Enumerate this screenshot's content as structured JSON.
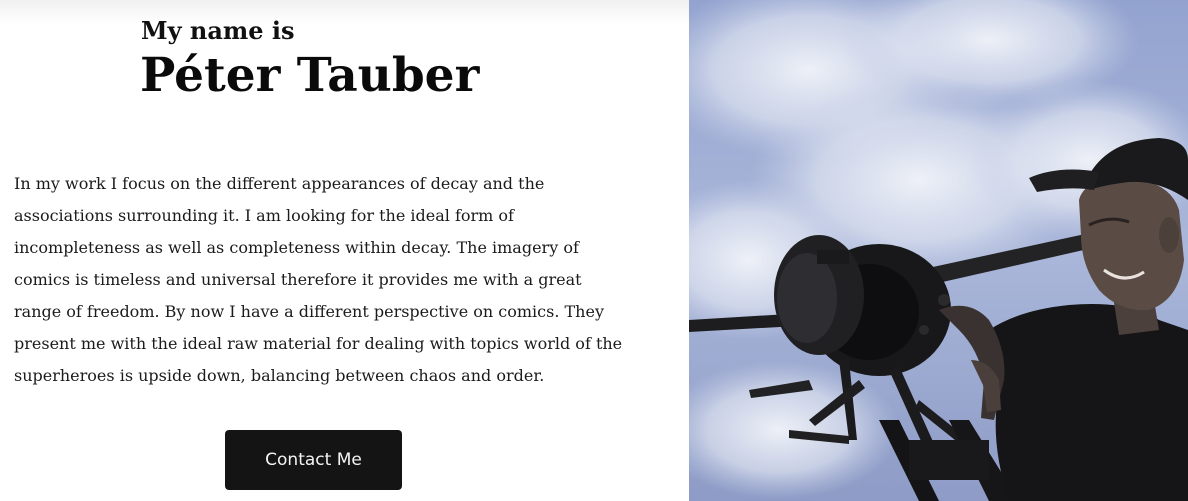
{
  "hero": {
    "intro": "My name is",
    "name": "Péter Tauber",
    "bio": "In my work I focus on the different appearances of decay and the associations surrounding it. I am looking for the ideal form of incompleteness as well as completeness within decay. The imagery of comics is timeless and universal therefore it provides me with a great range of freedom. By now I have a different perspective on comics. They present me with the ideal raw material for dealing with topics world of the superheroes is upside down, balancing between chaos and order.",
    "contact_label": "Contact Me"
  },
  "colors": {
    "button_bg": "#141414",
    "button_text": "#f4f4f4",
    "text": "#1b1b1b",
    "sky": "#8f9fc9"
  }
}
